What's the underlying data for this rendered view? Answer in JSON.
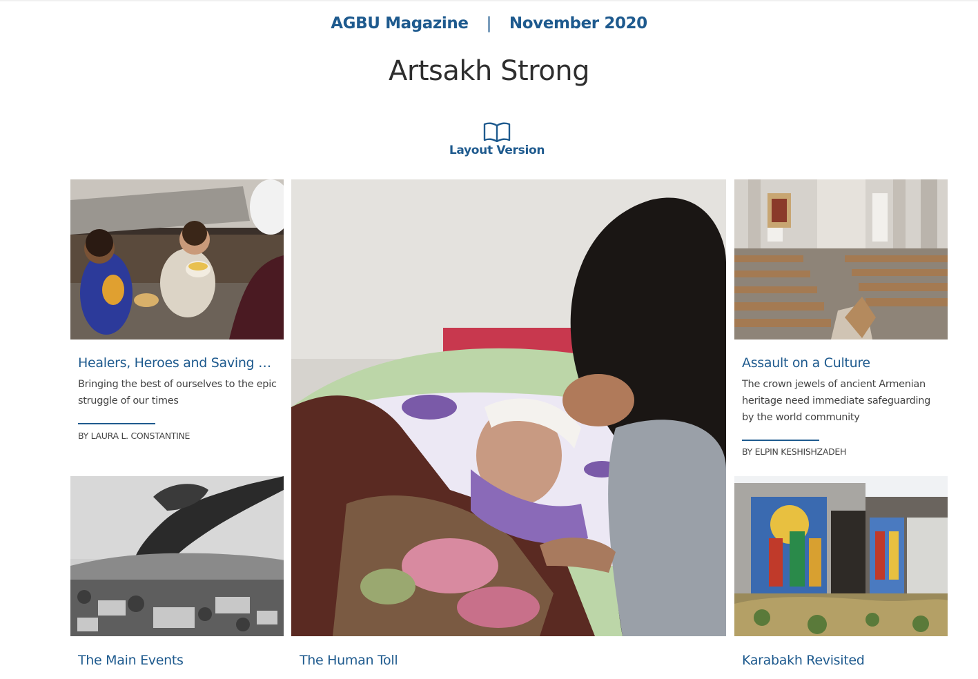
{
  "header": {
    "magazine": "AGBU Magazine",
    "separator": "|",
    "issue": "November 2020"
  },
  "page": {
    "title": "Artsakh Strong",
    "layout_link_label": "Layout Version"
  },
  "articles": [
    {
      "title": "Healers, Heroes and Saving Gr...",
      "description": "Bringing the best of ourselves to the epic struggle of our times",
      "byline": "BY LAURA L. CONSTANTINE",
      "image": "children-eating-photo"
    },
    {
      "title": "Assault on a Culture",
      "description": "The crown jewels of ancient Armenian heritage need immediate safeguarding by the world community",
      "byline": "BY ELPIN KESHISHZADEH",
      "image": "damaged-cathedral-photo"
    },
    {
      "title": "The Main Events",
      "image": "smoke-over-town-photo"
    },
    {
      "title": "The Human Toll",
      "image": "wounded-child-photo"
    },
    {
      "title": "Karabakh Revisited",
      "image": "mural-ruins-photo"
    }
  ],
  "colors": {
    "accent": "#1e5a8e",
    "title_text": "#2e2e2e",
    "body_text": "#444444"
  }
}
